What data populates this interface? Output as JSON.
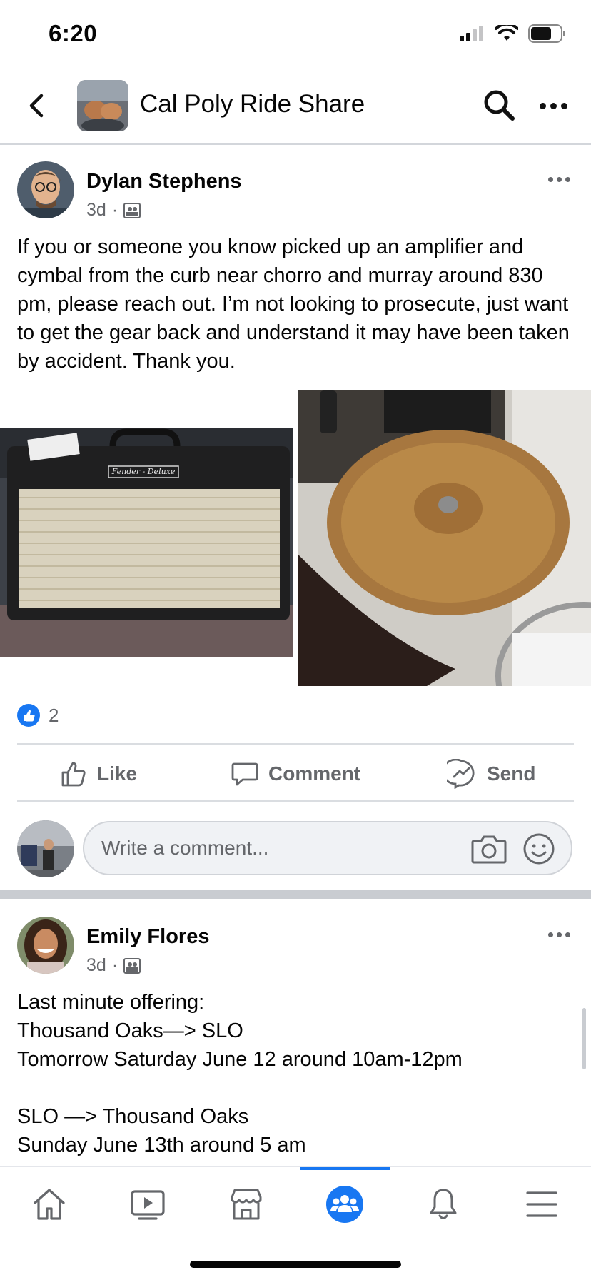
{
  "status": {
    "time": "6:20"
  },
  "header": {
    "title": "Cal Poly Ride Share"
  },
  "posts": [
    {
      "author": "Dylan Stephens",
      "age": "3d",
      "text": "If you or someone you know picked up an amplifier and cymbal from the curb near chorro and murray around 830 pm, please reach out. I’m not looking to prosecute, just want to get the gear back and understand it may have been taken by accident. Thank you.",
      "media_left_label": "Fender - Deluxe",
      "likes": "2",
      "actions": {
        "like": "Like",
        "comment": "Comment",
        "send": "Send"
      },
      "comment_placeholder": "Write a comment..."
    },
    {
      "author": "Emily Flores",
      "age": "3d",
      "lines": [
        "Last minute offering:",
        "Thousand Oaks—> SLO",
        "Tomorrow Saturday June 12 around 10am-12pm",
        "",
        "SLO —> Thousand Oaks",
        "Sunday June 13th around 5 am"
      ]
    }
  ],
  "nav": [
    "home-icon",
    "watch-icon",
    "marketplace-icon",
    "groups-icon",
    "notifications-icon",
    "menu-icon"
  ],
  "colors": {
    "accent": "#1877f2",
    "muted": "#65676b"
  }
}
